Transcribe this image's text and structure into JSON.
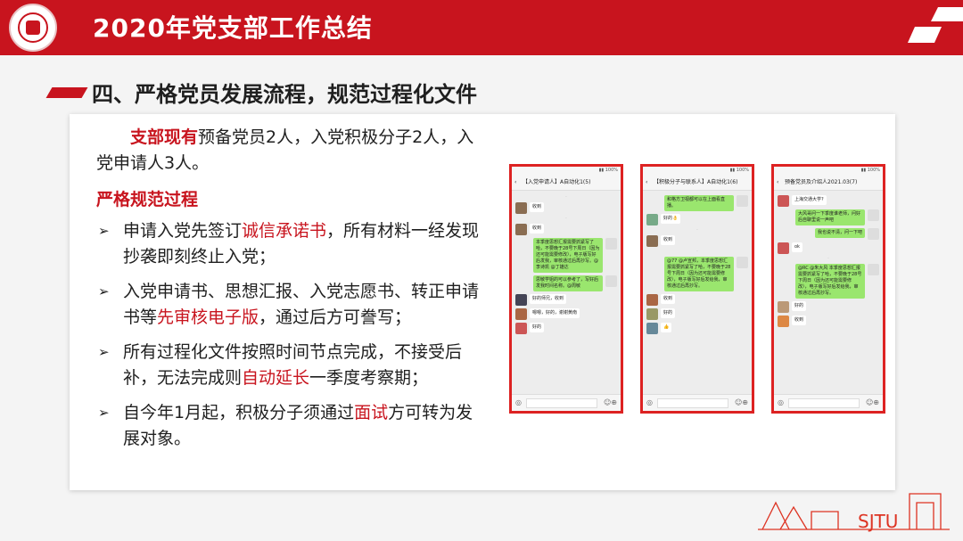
{
  "header": {
    "title": "2020年党支部工作总结",
    "brand_color": "#c8141e"
  },
  "section": {
    "title": "四、严格党员发展流程，规范过程化文件"
  },
  "content": {
    "intro_red": "支部现有",
    "intro_rest": "预备党员2人，入党积极分子2人，入党申请人3人。",
    "heading": "严格规范过程",
    "bullets": [
      {
        "pre": "申请入党先签订",
        "red": "诚信承诺书",
        "post": "，所有材料一经发现抄袭即刻终止入党；"
      },
      {
        "pre": "入党申请书、思想汇报、入党志愿书、转正申请书等",
        "red": "先审核电子版",
        "post": "，通过后方可誊写；"
      },
      {
        "pre": "所有过程化文件按照时间节点完成，不接受后补，无法完成则",
        "red": "自动延长",
        "post": "一季度考察期；"
      },
      {
        "pre": "自今年1月起，积极分子须通过",
        "red": "面试",
        "post": "方可转为发展对象。"
      }
    ]
  },
  "phones": [
    {
      "chat_title": "【入党申请人】A自动化1(5)",
      "messages": [
        {
          "side": "left",
          "text": "收到"
        },
        {
          "side": "left",
          "text": "收到"
        },
        {
          "side": "right",
          "text": "本季度思想汇报需要抓紧写了哈，不要晚于28号下周日（因为还可能需要修改），电子版写好后发我，审核通过后再抄写。@李诗凯 @丁雄达"
        },
        {
          "side": "right",
          "text": "思敏学姐的可以参考了，写好后发我时间名称。@周敏"
        },
        {
          "side": "left",
          "text": "好的师兄，收到"
        },
        {
          "side": "left",
          "text": "嗯嗯，好的，谢谢黄南"
        },
        {
          "side": "left",
          "text": "好的"
        }
      ]
    },
    {
      "chat_title": "【积极分子与联系人】A自动化1(6)",
      "messages": [
        {
          "side": "right",
          "text": "和格方卫视都可以在上面看直播。"
        },
        {
          "side": "left",
          "text": "好的👌"
        },
        {
          "side": "left",
          "text": "收到"
        },
        {
          "side": "right",
          "text": "@77 @卢宣邦，本季度思想汇报需要抓紧写了哈，不要晚于28号下周日（因为还可能需要修改），电子版写好后发给我，审核通过后再抄写。"
        },
        {
          "side": "left",
          "text": "收到"
        },
        {
          "side": "left",
          "text": "好的"
        },
        {
          "side": "left",
          "text": "👍"
        }
      ]
    },
    {
      "chat_title": "预备党员及介绍人2021.03(7)",
      "messages": [
        {
          "side": "left",
          "text": "上海交通大学?"
        },
        {
          "side": "right",
          "text": "大风哥问一下季度谁老师，问好后自聊里说一声吧"
        },
        {
          "side": "right",
          "text": "我也说不清，问一下吧"
        },
        {
          "side": "left",
          "text": "ok"
        },
        {
          "side": "right",
          "text": "@RC @朱大风 本季度思想汇报需要抓紧写了哈，不要晚于28号下周日（因为还可能需要修改），电子版写好后发给我，审核通过后再抄写。"
        },
        {
          "side": "left",
          "text": "好的"
        },
        {
          "side": "left",
          "text": "收到"
        }
      ]
    }
  ],
  "watermark": {
    "text": "SJTU"
  }
}
